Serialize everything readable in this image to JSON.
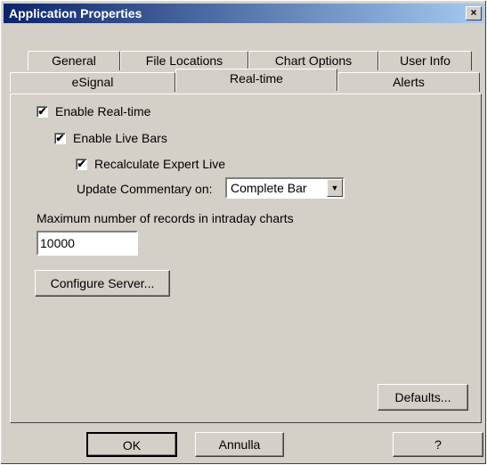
{
  "window": {
    "title": "Application Properties",
    "close_label": "×"
  },
  "tabs": {
    "general": "General",
    "file_locations": "File Locations",
    "chart_options": "Chart Options",
    "user_info": "User Info",
    "esignal": "eSignal",
    "realtime": "Real-time",
    "alerts": "Alerts"
  },
  "realtime": {
    "enable_realtime": {
      "label": "Enable Real-time",
      "checked": true
    },
    "enable_live_bars": {
      "label": "Enable Live Bars",
      "checked": true
    },
    "recalc_expert": {
      "label": "Recalculate Expert Live",
      "checked": true
    },
    "update_commentary_label": "Update Commentary on:",
    "update_commentary_value": "Complete Bar",
    "max_records_label": "Maximum number of records in intraday charts",
    "max_records_value": "10000",
    "configure_server": "Configure Server...",
    "defaults": "Defaults..."
  },
  "footer": {
    "ok": "OK",
    "cancel": "Annulla",
    "help": "?"
  },
  "colors": {
    "face": "#d4d0c8",
    "title_start": "#0a246a",
    "title_end": "#a6caf0"
  }
}
